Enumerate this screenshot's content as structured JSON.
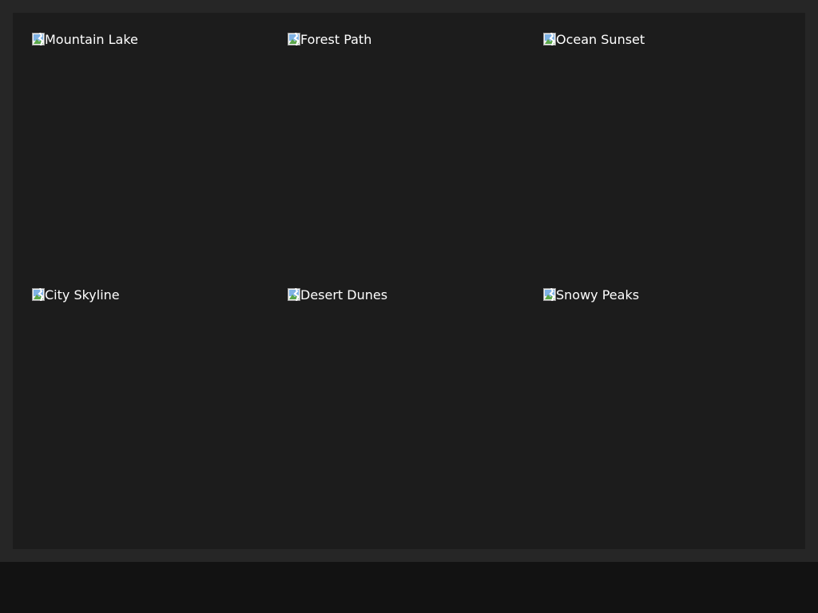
{
  "gallery": {
    "items": [
      {
        "alt": "Mountain Lake",
        "icon": "broken-image-icon"
      },
      {
        "alt": "Forest Path",
        "icon": "broken-image-icon"
      },
      {
        "alt": "Ocean Sunset",
        "icon": "broken-image-icon"
      },
      {
        "alt": "City Skyline",
        "icon": "broken-image-icon"
      },
      {
        "alt": "Desert Dunes",
        "icon": "broken-image-icon"
      },
      {
        "alt": "Snowy Peaks",
        "icon": "broken-image-icon"
      }
    ]
  },
  "colors": {
    "page_background": "#121212",
    "frame_background": "#262626",
    "gallery_background": "#1c1c1c",
    "text": "#ffffff"
  }
}
